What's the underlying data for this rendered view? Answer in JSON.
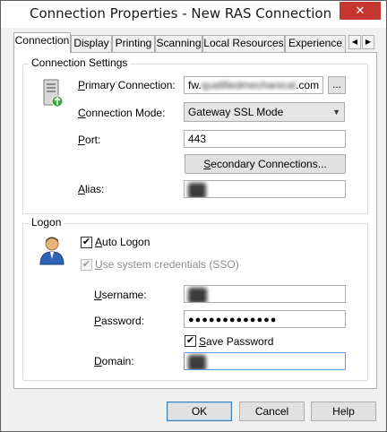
{
  "window": {
    "title": "Connection Properties - New RAS Connection",
    "close_glyph": "✕"
  },
  "tabs": [
    {
      "label": "Connection",
      "active": true
    },
    {
      "label": "Display"
    },
    {
      "label": "Printing"
    },
    {
      "label": "Scanning"
    },
    {
      "label": "Local Resources"
    },
    {
      "label": "Experience"
    }
  ],
  "tab_scroll": {
    "left": "◀",
    "right": "▶"
  },
  "connection_settings": {
    "title": "Connection Settings",
    "primary_label_pre": "Primary Connection",
    "primary_label_hot": "P",
    "primary_value_prefix": "fw.",
    "primary_value_redacted": "qualifiedmechanical",
    "primary_value_suffix": ".com",
    "browse_label": "...",
    "mode_label_hot": "C",
    "mode_label_rest": "onnection Mode:",
    "mode_value": "Gateway SSL Mode",
    "port_label_hot": "P",
    "port_label_rest": "ort:",
    "port_value": "443",
    "secondary_button_hot": "S",
    "secondary_button_rest": "econdary Connections...",
    "alias_label_hot": "A",
    "alias_label_rest": "lias:",
    "alias_value": "QM"
  },
  "logon": {
    "title": "Logon",
    "auto_logon_hot": "A",
    "auto_logon_rest": "uto Logon",
    "auto_logon_checked": true,
    "sso_hot": "U",
    "sso_rest": "se system credentials (SSO)",
    "sso_checked": true,
    "username_label_hot": "U",
    "username_label_rest": "sername:",
    "username_value": "bob",
    "password_label_hot": "P",
    "password_label_rest": "assword:",
    "password_value": "●●●●●●●●●●●●●",
    "save_password_hot": "S",
    "save_password_rest": "ave Password",
    "save_password_checked": true,
    "domain_label_hot": "D",
    "domain_label_rest": "omain:",
    "domain_value": "QM"
  },
  "buttons": {
    "ok": "OK",
    "cancel": "Cancel",
    "help": "Help"
  },
  "check_glyph": "✔"
}
